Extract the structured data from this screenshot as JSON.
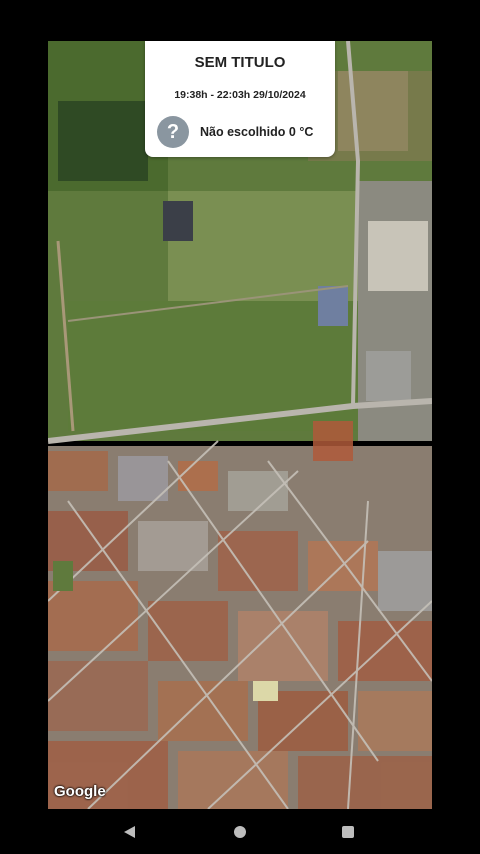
{
  "card": {
    "title": "SEM TITULO",
    "time_range": "19:38h - 22:03h  29/10/2024",
    "status_icon": "help-icon",
    "status_text": "Não escolhido  0 °C"
  },
  "map": {
    "attribution": "Google",
    "type": "satellite"
  },
  "navigation": {
    "back": "back-icon",
    "home": "home-icon",
    "recents": "recents-icon"
  }
}
